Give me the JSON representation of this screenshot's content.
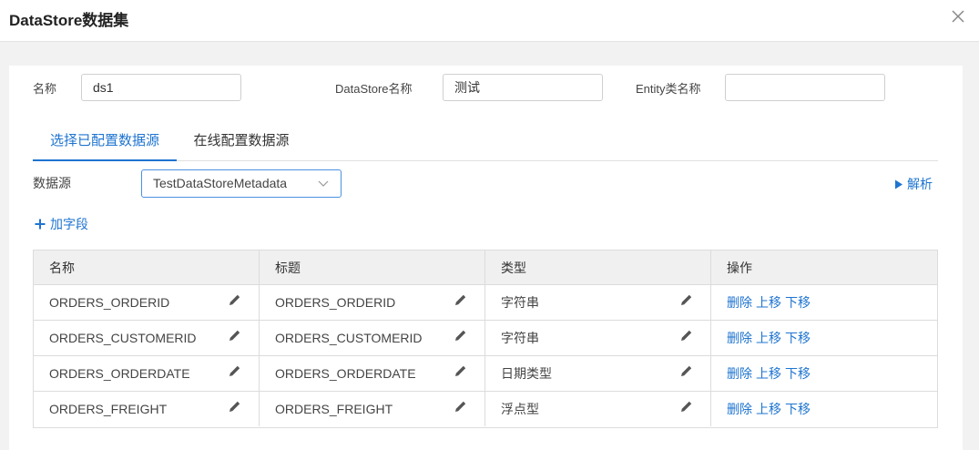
{
  "dialog": {
    "title": "DataStore数据集"
  },
  "form": {
    "name_label": "名称",
    "name_value": "ds1",
    "datastore_label": "DataStore名称",
    "datastore_value": "测试",
    "entity_label": "Entity类名称",
    "entity_value": ""
  },
  "tabs": [
    {
      "label": "选择已配置数据源",
      "active": true
    },
    {
      "label": "在线配置数据源",
      "active": false
    }
  ],
  "datasource": {
    "label": "数据源",
    "selected": "TestDataStoreMetadata",
    "parse_label": "解析"
  },
  "add_field_label": "加字段",
  "table": {
    "headers": [
      "名称",
      "标题",
      "类型",
      "操作"
    ],
    "rows": [
      {
        "name": "ORDERS_ORDERID",
        "title": "ORDERS_ORDERID",
        "type": "字符串"
      },
      {
        "name": "ORDERS_CUSTOMERID",
        "title": "ORDERS_CUSTOMERID",
        "type": "字符串"
      },
      {
        "name": "ORDERS_ORDERDATE",
        "title": "ORDERS_ORDERDATE",
        "type": "日期类型"
      },
      {
        "name": "ORDERS_FREIGHT",
        "title": "ORDERS_FREIGHT",
        "type": "浮点型"
      }
    ],
    "actions": {
      "delete": "删除",
      "up": "上移",
      "down": "下移"
    }
  },
  "colors": {
    "accent": "#1e74d0",
    "border": "#dcdcdc",
    "header_bg": "#f0f0f0"
  }
}
